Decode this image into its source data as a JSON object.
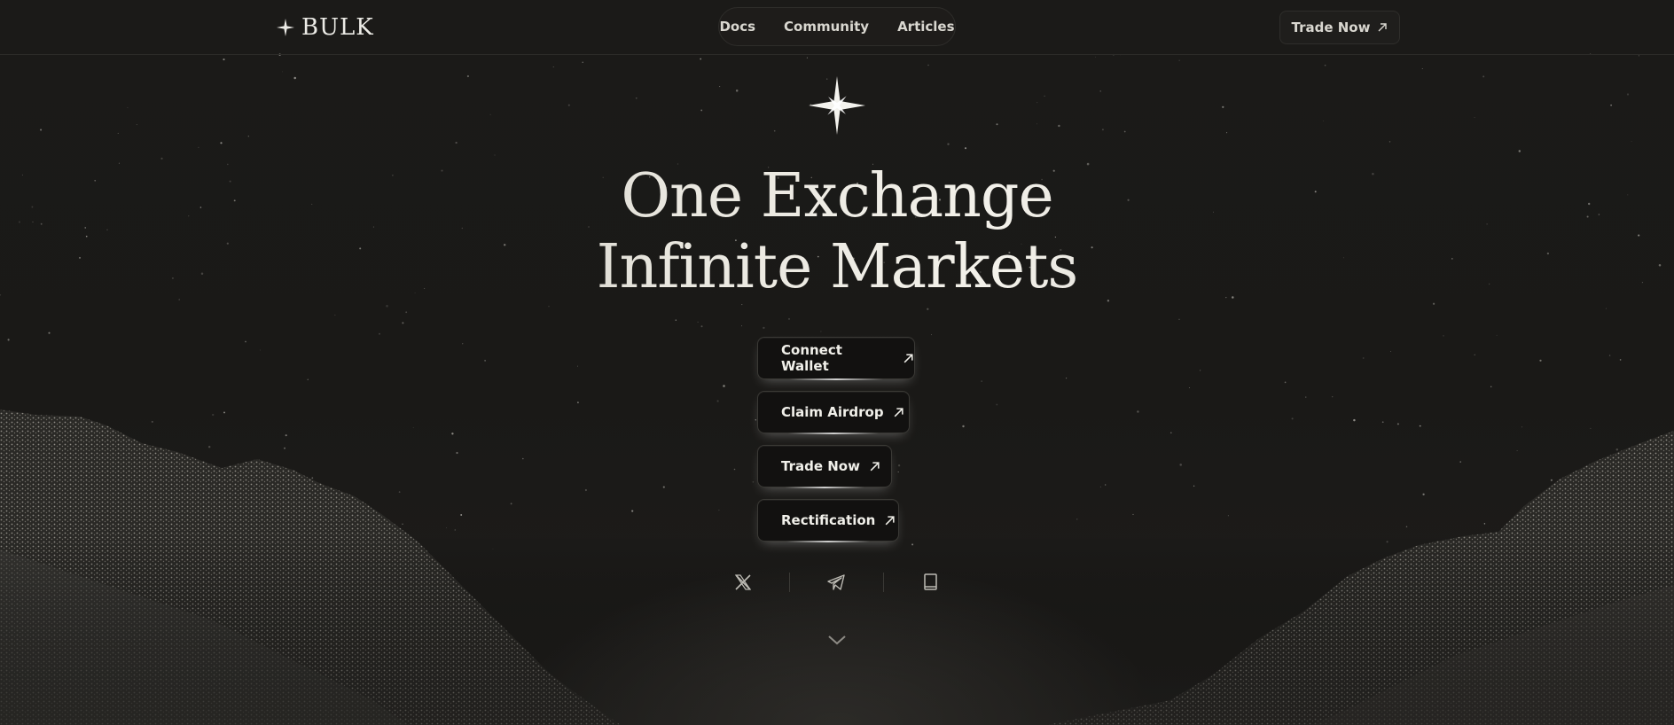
{
  "brand": {
    "logo_text": "BULK",
    "icon": "four-point-star-icon"
  },
  "nav": {
    "links": [
      {
        "label": "Docs"
      },
      {
        "label": "Community"
      },
      {
        "label": "Articles"
      }
    ],
    "trade_button": {
      "label": "Trade Now",
      "icon": "arrow-up-right-icon"
    }
  },
  "hero": {
    "icon": "four-point-star-icon",
    "headline_line1": "One Exchange",
    "headline_line2": "Infinite Markets",
    "buttons": [
      {
        "label": "Connect Wallet",
        "icon": "arrow-up-right-icon"
      },
      {
        "label": "Claim Airdrop",
        "icon": "arrow-up-right-icon"
      },
      {
        "label": "Trade Now",
        "icon": "arrow-up-right-icon"
      },
      {
        "label": "Rectification",
        "icon": "arrow-up-right-icon"
      }
    ]
  },
  "socials": [
    {
      "icon": "x-twitter-icon"
    },
    {
      "icon": "telegram-icon"
    },
    {
      "icon": "book-icon"
    }
  ],
  "scroll_indicator": {
    "icon": "chevron-down-icon"
  },
  "colors": {
    "background": "#1b1a18",
    "text": "#ecebe6",
    "button_bg": "#121110",
    "border": "#3a3935"
  }
}
